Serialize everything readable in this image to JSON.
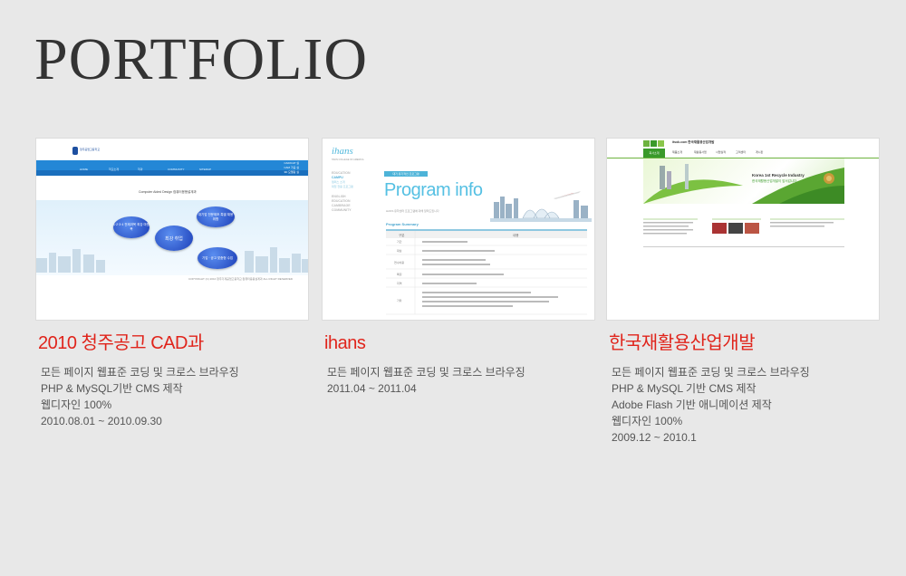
{
  "page": {
    "title": "PORTFOLIO"
  },
  "colors": {
    "accent": "#e0241b",
    "background": "#e8e8e8"
  },
  "items": [
    {
      "title": "2010 청주공고 CAD과",
      "lines": [
        "모든 페이지 웹표준 코딩 및 크로스 브라우징",
        "PHP & MySQL기반 CMS 제작",
        "웹디자인 100%",
        "2010.08.01 ~ 2010.09.30"
      ]
    },
    {
      "title": "ihans",
      "lines": [
        "모든 페이지 웹표준 코딩 및 크로스 브라우징",
        "2011.04 ~ 2011.04"
      ]
    },
    {
      "title": "한국재활용산업개발",
      "lines": [
        "모든 페이지 웹표준 코딩 및 크로스 브라우징",
        "PHP & MySQL 기반 CMS 제작",
        "Adobe Flash 기반 애니메이션 제작",
        "웹디자인 100%",
        "2009.12 ~ 2010.1"
      ]
    },
    {}
  ],
  "thumb1": {
    "logo": "청주공업고등학교",
    "nav": [
      "HOME",
      "학교소개",
      "학과",
      "COMMUNITY",
      "SITEMAP"
    ],
    "side": [
      "CAD/CAT 실",
      "CAM 가공 실",
      "3D 모델링 실"
    ],
    "caption": "Computer Aided Design 컴퓨터응용설계과",
    "bubbles": [
      "1·2·3·4 전제과목 최강 마원복",
      "대기업 전문제조 특별 채용 위함",
      "최강 취업",
      "기업 · 공고 맞춤형 수업"
    ],
    "footer": "COPYRIGHT (C) 2010 청주기계공업고등학교 컴퓨터응용설계과 ALL RIGHT RESERVED"
  },
  "thumb2": {
    "logo": "ihans",
    "logo_sub": "HANS COLLEGE OF AMERICA",
    "menu": [
      "EDUCATION",
      "CAMPU",
      "캠퍼스 소개",
      "대입 전용 프로그램",
      "ENGLISH",
      "EDUCATION",
      "CAMBRAGE",
      "COMMUNITY"
    ],
    "badge": "대기 유기적인 프로그램",
    "heading": "Program info",
    "sub": "HANS 유학센터 프로그램에 대해 알려드립니다",
    "summary": "Program Summary",
    "table_headers": [
      "구분",
      "내용"
    ],
    "table_rows": [
      "기간",
      "대상",
      "연수비용",
      "특징",
      "지역",
      "기타"
    ]
  },
  "thumb3": {
    "logo_text": "itsok.com 한국재활용산업개발",
    "nav": [
      "회사소개",
      "제품소개",
      "재활용사업",
      "사업실적",
      "고객센터",
      "게시판"
    ],
    "banner_title": "Korea 1st Recycle Industry",
    "banner_sub": "한국재활용산업개발이 앞서갑니다."
  }
}
